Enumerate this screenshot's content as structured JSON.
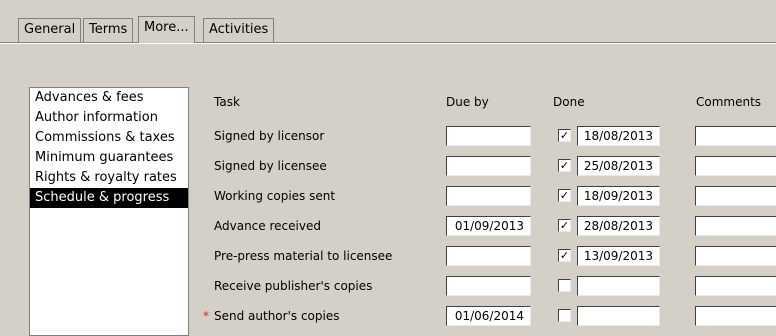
{
  "tabs": [
    "General",
    "Terms",
    "More...",
    "Activities"
  ],
  "active_tab": "More...",
  "sections": [
    "Advances & fees",
    "Author information",
    "Commissions & taxes",
    "Minimum guarantees",
    "Rights & royalty rates",
    "Schedule & progress"
  ],
  "selected_section": "Schedule & progress",
  "columns": {
    "task": "Task",
    "due_by": "Due by",
    "done": "Done",
    "comments": "Comments"
  },
  "rows": [
    {
      "task": "Signed by licensor",
      "due_by": "",
      "done": true,
      "done_date": "18/08/2013",
      "comments": "",
      "required": false
    },
    {
      "task": "Signed by licensee",
      "due_by": "",
      "done": true,
      "done_date": "25/08/2013",
      "comments": "",
      "required": false
    },
    {
      "task": "Working copies sent",
      "due_by": "",
      "done": true,
      "done_date": "18/09/2013",
      "comments": "",
      "required": false
    },
    {
      "task": "Advance received",
      "due_by": "01/09/2013",
      "done": true,
      "done_date": "28/08/2013",
      "comments": "",
      "required": false
    },
    {
      "task": "Pre-press material to licensee",
      "due_by": "",
      "done": true,
      "done_date": "13/09/2013",
      "comments": "",
      "required": false
    },
    {
      "task": "Receive publisher's copies",
      "due_by": "",
      "done": false,
      "done_date": "",
      "comments": "",
      "required": false
    },
    {
      "task": "Send author's copies",
      "due_by": "01/06/2014",
      "done": false,
      "done_date": "",
      "comments": "",
      "required": true
    }
  ],
  "required_marker": "*",
  "check_glyph": "✓"
}
